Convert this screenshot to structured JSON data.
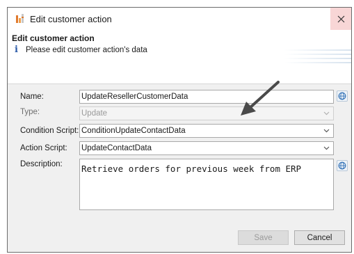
{
  "window": {
    "title": "Edit customer action",
    "icon": "app-icon",
    "close_icon": "close-icon"
  },
  "header": {
    "title": "Edit customer action",
    "subtitle": "Please edit customer action's data",
    "icon": "info-icon"
  },
  "form": {
    "name_label": "Name:",
    "name_value": "UpdateResellerCustomerData",
    "type_label": "Type:",
    "type_value": "Update",
    "condition_label": "Condition Script:",
    "condition_value": "ConditionUpdateContactData",
    "action_label": "Action Script:",
    "action_value": "UpdateContactData",
    "description_label": "Description:",
    "description_value": "Retrieve orders for previous week from ERP"
  },
  "buttons": {
    "save": "Save",
    "cancel": "Cancel"
  },
  "colors": {
    "close_hover": "#f8d6d6",
    "arrow": "#4a4a4a",
    "globe": "#2f6fb5"
  }
}
